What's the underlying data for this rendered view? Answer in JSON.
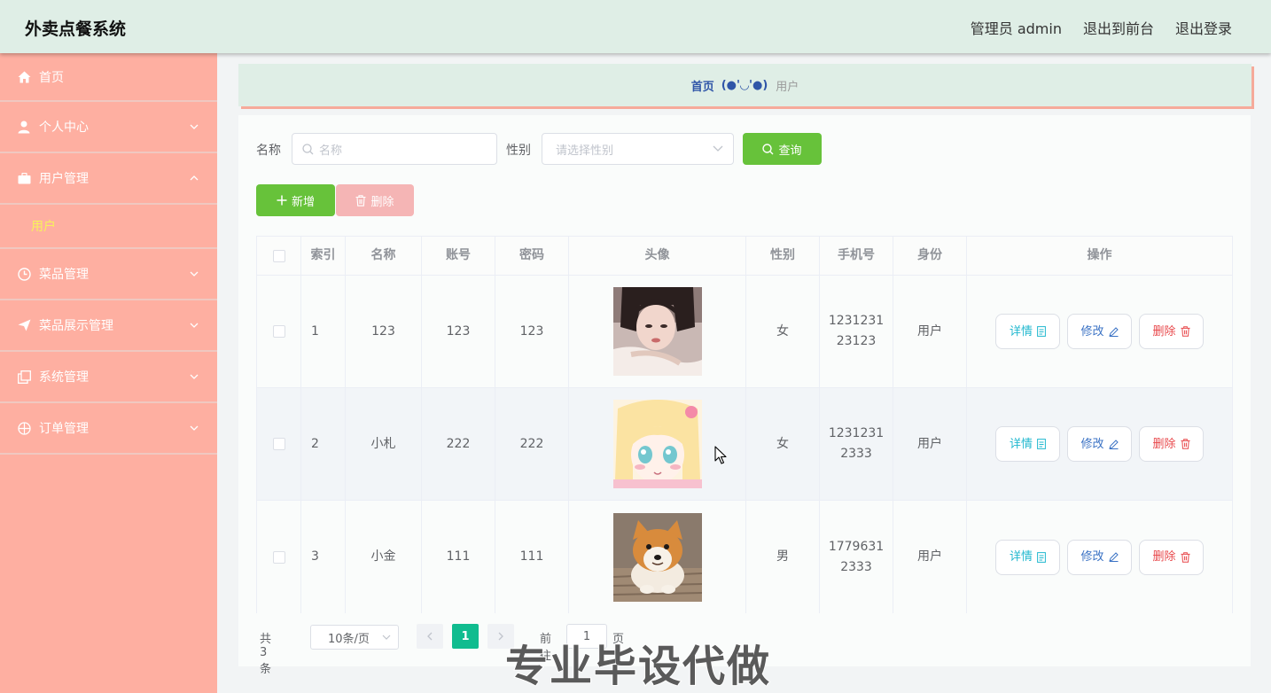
{
  "header": {
    "title": "外卖点餐系统",
    "admin_label": "管理员 admin",
    "to_front": "退出到前台",
    "logout": "退出登录"
  },
  "sidebar": {
    "items": [
      {
        "label": "首页",
        "icon": "home-icon"
      },
      {
        "label": "个人中心",
        "icon": "user-icon"
      },
      {
        "label": "用户管理",
        "icon": "briefcase-icon",
        "expanded": true
      },
      {
        "label": "菜品管理",
        "icon": "clock-icon"
      },
      {
        "label": "菜品展示管理",
        "icon": "send-icon"
      },
      {
        "label": "系统管理",
        "icon": "copy-icon"
      },
      {
        "label": "订单管理",
        "icon": "crosshair-icon"
      }
    ],
    "sub_items": [
      {
        "label": "用户"
      }
    ]
  },
  "breadcrumb": {
    "home": "首页",
    "separator": "(●'◡'●)",
    "current": "用户"
  },
  "search": {
    "name_label": "名称",
    "name_placeholder": "名称",
    "gender_label": "性别",
    "gender_placeholder": "请选择性别",
    "query_button": "查询"
  },
  "actions": {
    "add_button": "新增",
    "delete_button": "删除"
  },
  "table": {
    "columns": [
      "索引",
      "名称",
      "账号",
      "密码",
      "头像",
      "性别",
      "手机号",
      "身份",
      "操作"
    ],
    "rows": [
      {
        "index": "1",
        "name": "123",
        "account": "123",
        "password": "123",
        "avatar": "girl-photo",
        "gender": "女",
        "phone": "1231231 23123",
        "role": "用户"
      },
      {
        "index": "2",
        "name": "小札",
        "account": "222",
        "password": "222",
        "avatar": "anime-girl-illustration",
        "gender": "女",
        "phone": "1231231 2333",
        "role": "用户"
      },
      {
        "index": "3",
        "name": "小金",
        "account": "111",
        "password": "111",
        "avatar": "shiba-dog-photo",
        "gender": "男",
        "phone": "1779631 2333",
        "role": "用户"
      }
    ],
    "op_labels": {
      "detail": "详情",
      "edit": "修改",
      "delete": "删除"
    }
  },
  "pagination": {
    "total": "共 3 条",
    "page_size": "10条/页",
    "current_page": "1",
    "goto_label": "前往",
    "goto_value": "1",
    "page_suffix": "页"
  },
  "watermark": "专业毕设代做",
  "colors": {
    "header_bg": "#dfeee6",
    "sidebar_bg": "#feafa1",
    "primary_green": "#67c23a",
    "danger_light": "#f5b5b5",
    "page_active": "#10bc8f",
    "submenu_active": "#f7f25a"
  }
}
